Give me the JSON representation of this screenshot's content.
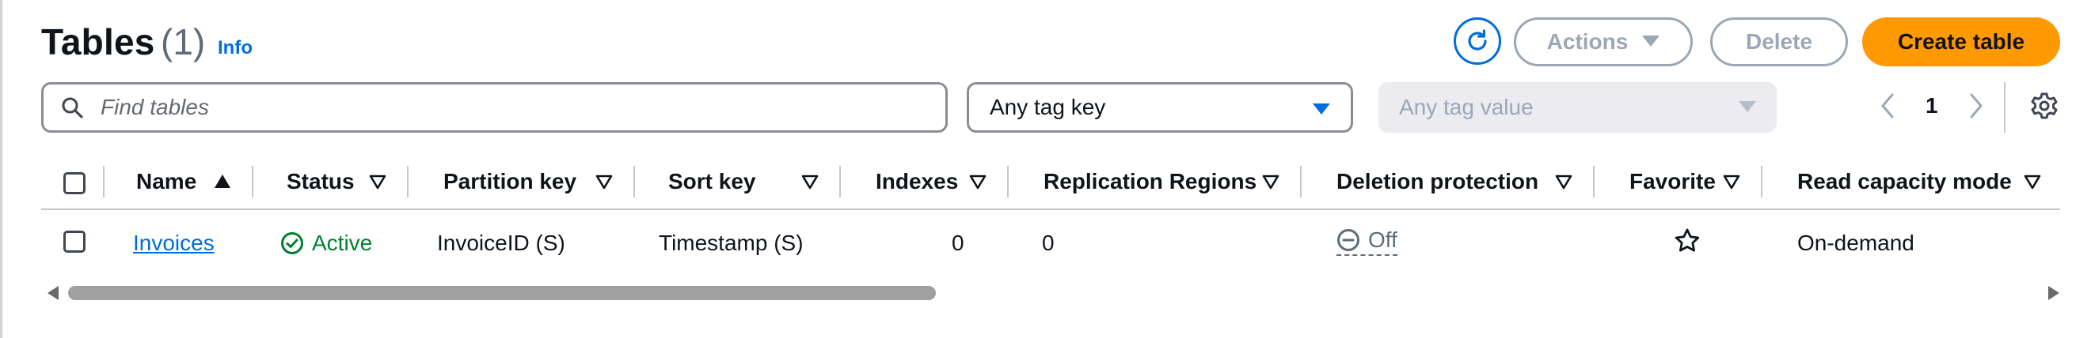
{
  "header": {
    "title": "Tables",
    "count": "(1)",
    "info_label": "Info",
    "refresh_icon": "refresh-icon",
    "actions_label": "Actions",
    "delete_label": "Delete",
    "create_label": "Create table",
    "accent_color": "#006ce0",
    "primary_color": "#ff9900"
  },
  "filters": {
    "search_placeholder": "Find tables",
    "search_value": "",
    "tag_key": "Any tag key",
    "tag_value": "Any tag value"
  },
  "pagination": {
    "current_page": "1"
  },
  "table": {
    "columns": [
      "Name",
      "Status",
      "Partition key",
      "Sort key",
      "Indexes",
      "Replication Regions",
      "Deletion protection",
      "Favorite",
      "Read capacity mode"
    ],
    "sorted_column": "Name",
    "sort_direction": "ascending",
    "rows": [
      {
        "name": "Invoices",
        "status": "Active",
        "partition_key": "InvoiceID (S)",
        "sort_key": "Timestamp (S)",
        "indexes": "0",
        "replication_regions": "0",
        "deletion_protection": "Off",
        "favorite": false,
        "read_capacity_mode": "On-demand"
      }
    ]
  },
  "scrollbar": {
    "visible_fraction": 0.44,
    "position_fraction": 0
  },
  "status_colors": {
    "active": "#00802f",
    "off": "#5f6b7a"
  }
}
